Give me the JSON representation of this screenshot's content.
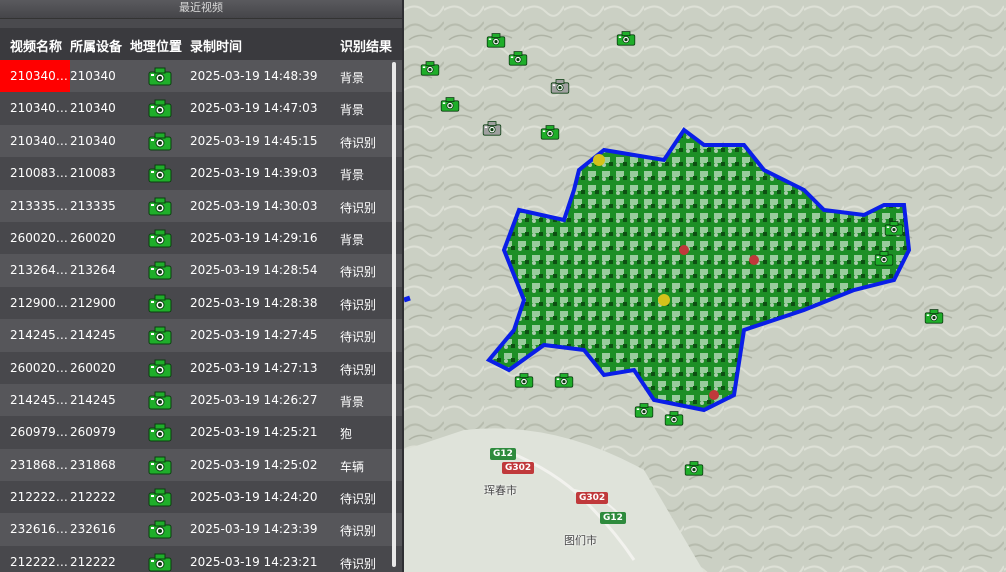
{
  "panel": {
    "title": "最近视频",
    "columns": {
      "name": "视频名称",
      "device": "所属设备",
      "location": "地理位置",
      "time": "录制时间",
      "result": "识别结果"
    },
    "rows": [
      {
        "name": "210340_...",
        "device": "210340",
        "time": "2025-03-19 14:48:39",
        "result": "背景"
      },
      {
        "name": "210340_...",
        "device": "210340",
        "time": "2025-03-19 14:47:03",
        "result": "背景"
      },
      {
        "name": "210340_...",
        "device": "210340",
        "time": "2025-03-19 14:45:15",
        "result": "待识别"
      },
      {
        "name": "210083_...",
        "device": "210083",
        "time": "2025-03-19 14:39:03",
        "result": "背景"
      },
      {
        "name": "213335_...",
        "device": "213335",
        "time": "2025-03-19 14:30:03",
        "result": "待识别"
      },
      {
        "name": "260020_...",
        "device": "260020",
        "time": "2025-03-19 14:29:16",
        "result": "背景"
      },
      {
        "name": "213264_...",
        "device": "213264",
        "time": "2025-03-19 14:28:54",
        "result": "待识别"
      },
      {
        "name": "212900_...",
        "device": "212900",
        "time": "2025-03-19 14:28:38",
        "result": "待识别"
      },
      {
        "name": "214245_...",
        "device": "214245",
        "time": "2025-03-19 14:27:45",
        "result": "待识别"
      },
      {
        "name": "260020_...",
        "device": "260020",
        "time": "2025-03-19 14:27:13",
        "result": "待识别"
      },
      {
        "name": "214245_...",
        "device": "214245",
        "time": "2025-03-19 14:26:27",
        "result": "背景"
      },
      {
        "name": "260979_...",
        "device": "260979",
        "time": "2025-03-19 14:25:21",
        "result": "狍"
      },
      {
        "name": "231868_...",
        "device": "231868",
        "time": "2025-03-19 14:25:02",
        "result": "车辆"
      },
      {
        "name": "212222_...",
        "device": "212222",
        "time": "2025-03-19 14:24:20",
        "result": "待识别"
      },
      {
        "name": "232616_...",
        "device": "232616",
        "time": "2025-03-19 14:23:39",
        "result": "待识别"
      },
      {
        "name": "212222_...",
        "device": "212222",
        "time": "2025-03-19 14:23:21",
        "result": "待识别"
      }
    ]
  },
  "map": {
    "road_labels": [
      {
        "text": "G12",
        "kind": "g"
      },
      {
        "text": "G302",
        "kind": "r"
      },
      {
        "text": "G302",
        "kind": "r"
      },
      {
        "text": "G12",
        "kind": "g"
      }
    ],
    "places": [
      "珲春市",
      "图们市"
    ],
    "colors": {
      "boundary": "#0a1ee8",
      "camera_online": "#1fae2a",
      "camera_alert": "#d4c21a",
      "camera_offline": "#a0a0a0"
    }
  }
}
